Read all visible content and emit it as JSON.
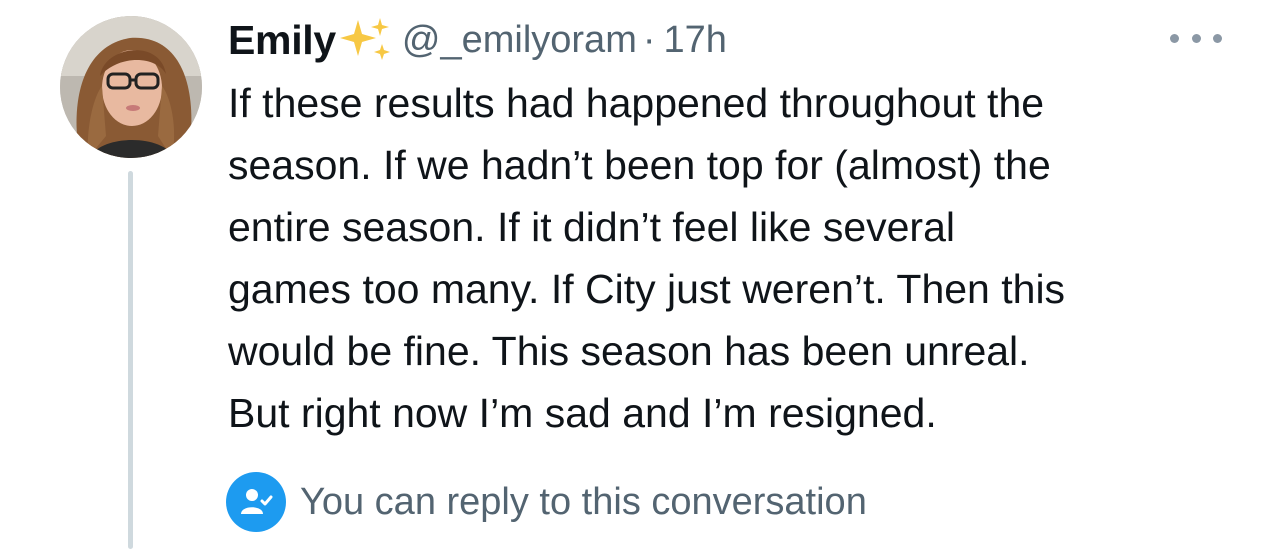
{
  "tweet": {
    "author_name": "Emily",
    "author_emoji": "✨",
    "handle": "@_emilyoram",
    "separator": "·",
    "timestamp": "17h",
    "text_lines": [
      "If these results had happened throughout the",
      "season. If we hadn’t been top for (almost) the",
      "entire season. If it didn’t feel like several",
      "games too many. If City just weren’t. Then this",
      "would be fine. This season has been unreal.",
      "But right now I’m sad and I’m resigned."
    ]
  },
  "reply_notice": {
    "text": "You can reply to this conversation",
    "icon": "user-check-icon"
  },
  "icons": {
    "more": "more-horizontal-icon",
    "avatar": "profile-avatar",
    "sparkle": "sparkles-icon"
  },
  "colors": {
    "text_primary": "#0f1419",
    "text_secondary": "#536471",
    "accent": "#1d9bf0",
    "thread_line": "#cfd9de",
    "sparkle": "#f7c844"
  }
}
